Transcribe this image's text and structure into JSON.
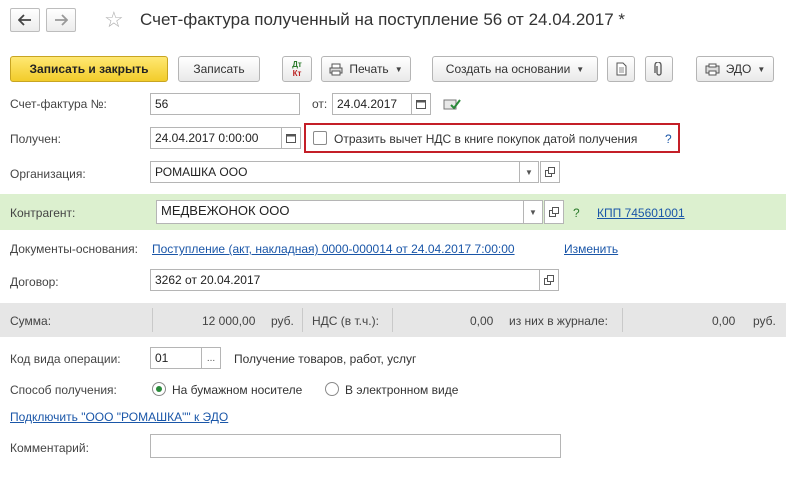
{
  "window": {
    "title": "Счет-фактура полученный на поступление 56 от 24.04.2017 *"
  },
  "nav": {
    "back_glyph": "🡐",
    "forward_glyph": "🡒",
    "back_icon": "arrow-left-icon",
    "forward_icon": "arrow-right-icon"
  },
  "toolbar": {
    "save_close": "Записать и закрыть",
    "save": "Записать",
    "dtkt_top": "Дт",
    "dtkt_bottom": "Кт",
    "print": "Печать",
    "create_based": "Создать на основании",
    "edo": "ЭДО"
  },
  "form": {
    "invoice_no_label": "Счет-фактура №:",
    "invoice_no_value": "56",
    "from_label": "от:",
    "invoice_date": "24.04.2017",
    "received_label": "Получен:",
    "received_value": "24.04.2017  0:00:00",
    "vat_checkbox_label": "Отразить вычет НДС в книге покупок датой получения",
    "help_mark": "?",
    "org_label": "Организация:",
    "org_value": "РОМАШКА ООО",
    "contractor_label": "Контрагент:",
    "contractor_value": "МЕДВЕЖОНОК ООО",
    "contractor_help": "?",
    "kpp_link": "КПП 745601001",
    "docs_label": "Документы-основания:",
    "docs_link": "Поступление (акт, накладная) 0000-000014 от 24.04.2017 7:00:00",
    "change_link": "Изменить",
    "contract_label": "Договор:",
    "contract_value": "3262 от 20.04.2017",
    "sum_label": "Сумма:",
    "sum_value": "12 000,00",
    "currency1": "руб.",
    "vat_label": "НДС (в т.ч.):",
    "vat_value": "0,00",
    "journal_label": "из них в журнале:",
    "journal_value": "0,00",
    "currency2": "руб.",
    "op_code_label": "Код вида операции:",
    "op_code_value": "01",
    "op_code_ellipsis": "...",
    "op_code_desc": "Получение товаров, работ, услуг",
    "receive_method_label": "Способ получения:",
    "paper_option": "На бумажном носителе",
    "electronic_option": "В электронном виде",
    "connect_edo_link": "Подключить \"ООО \"РОМАШКА\"\" к ЭДО",
    "comment_label": "Комментарий:",
    "comment_value": ""
  }
}
